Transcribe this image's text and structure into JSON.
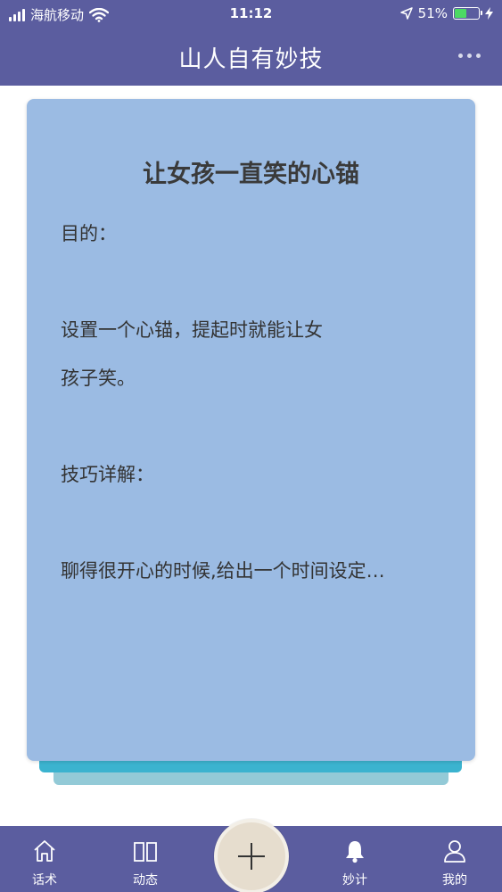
{
  "status_bar": {
    "carrier": "海航移动",
    "time": "11:12",
    "battery_percent": "51%",
    "battery_level": 0.51,
    "battery_color": "#4cd964"
  },
  "nav": {
    "title": "山人自有妙技",
    "more_icon": "more-dots-icon"
  },
  "card": {
    "title": "让女孩一直笑的心锚",
    "lines": [
      "目的：",
      "",
      "设置一个心锚，提起时就能让女",
      "孩子笑。",
      "",
      "技巧详解：",
      "",
      "聊得很开心的时候,给出一个时间设定…"
    ]
  },
  "tabs": [
    {
      "label": "话术",
      "icon": "home-icon"
    },
    {
      "label": "动态",
      "icon": "book-icon"
    },
    {
      "label": "妙计",
      "icon": "bell-icon"
    },
    {
      "label": "我的",
      "icon": "user-icon"
    }
  ],
  "fab": {
    "icon": "plus-icon"
  },
  "colors": {
    "header": "#5b5d9f",
    "card": "#9bbbe3",
    "card_stack_1": "#3bb3cf",
    "card_stack_2": "#93cad7",
    "fab": "#e6ddce"
  }
}
